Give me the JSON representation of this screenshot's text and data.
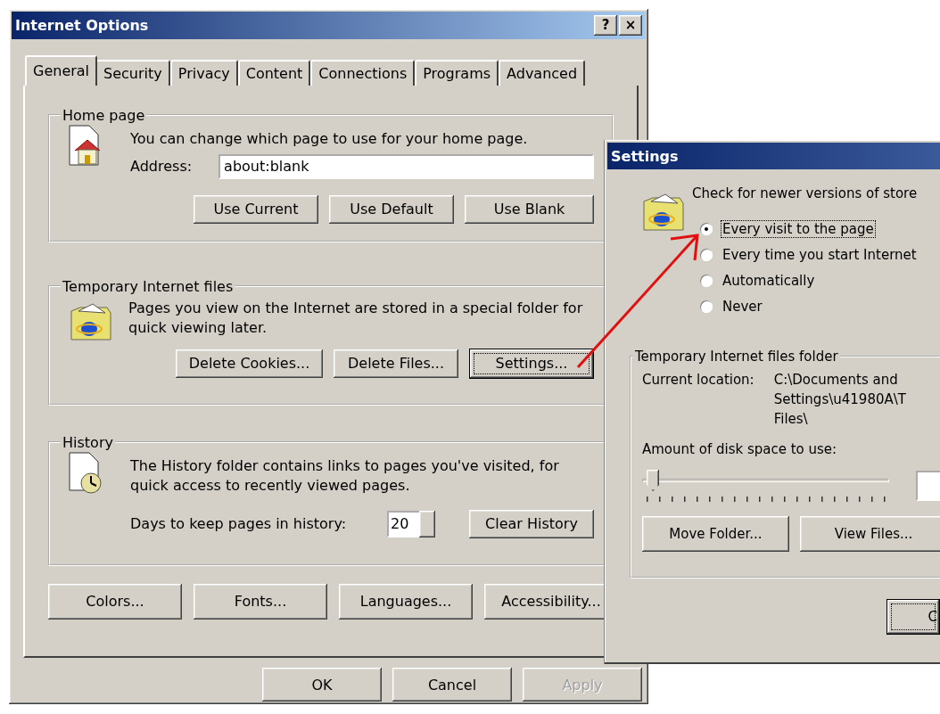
{
  "main_window": {
    "title": "Internet Options",
    "title_buttons": [
      "?",
      "×"
    ],
    "tabs": [
      {
        "label": "General",
        "selected": true
      },
      {
        "label": "Security",
        "selected": false
      },
      {
        "label": "Privacy",
        "selected": false
      },
      {
        "label": "Content",
        "selected": false
      },
      {
        "label": "Connections",
        "selected": false
      },
      {
        "label": "Programs",
        "selected": false
      },
      {
        "label": "Advanced",
        "selected": false
      }
    ],
    "home_page": {
      "title": "Home page",
      "description": "You can change which page to use for your home page.",
      "address_label": "Address:",
      "address_value": "about:blank",
      "buttons": [
        {
          "label": "Use Current",
          "focused": false
        },
        {
          "label": "Use Default",
          "focused": false
        },
        {
          "label": "Use Blank",
          "focused": false
        }
      ]
    },
    "temporary_files": {
      "title": "Temporary Internet files",
      "description": "Pages you view on the Internet are stored in a special folder for quick viewing later.",
      "buttons": [
        {
          "label": "Delete Cookies...",
          "focused": false
        },
        {
          "label": "Delete Files...",
          "focused": false
        },
        {
          "label": "Settings...",
          "focused": true
        }
      ]
    },
    "history": {
      "title": "History",
      "description": "The History folder contains links to pages you've visited, for quick access to recently viewed pages.",
      "days_label": "Days to keep pages in history:",
      "days_value": "20",
      "button": {
        "label": "Clear History",
        "focused": false
      }
    },
    "bottom_buttons": [
      {
        "label": "Colors...",
        "focused": false
      },
      {
        "label": "Fonts...",
        "focused": false
      },
      {
        "label": "Languages...",
        "focused": false
      },
      {
        "label": "Accessibility...",
        "focused": false
      }
    ],
    "dialog_buttons": [
      {
        "label": "OK",
        "disabled": false
      },
      {
        "label": "Cancel",
        "disabled": false
      },
      {
        "label": "Apply",
        "disabled": true
      }
    ]
  },
  "settings_window": {
    "title": "Settings",
    "prompt": "Check for newer versions of store",
    "options": [
      {
        "label": "Every visit to the page",
        "selected": true
      },
      {
        "label": "Every time you start Internet",
        "selected": false
      },
      {
        "label": "Automatically",
        "selected": false
      },
      {
        "label": "Never",
        "selected": false
      }
    ],
    "folder_group": {
      "title": "Temporary Internet files folder",
      "location_label": "Current location:",
      "location_lines": [
        "C:\\Documents and",
        "Settings\\u41980A\\T",
        "Files\\"
      ],
      "disk_label": "Amount of disk space to use:",
      "slider": {
        "level": 0.02
      },
      "buttons": [
        {
          "label": "Move Folder...",
          "focused": false
        },
        {
          "label": "View Files...",
          "focused": false
        }
      ]
    },
    "dialog_buttons": [
      {
        "label": "C",
        "disabled": false
      }
    ]
  }
}
